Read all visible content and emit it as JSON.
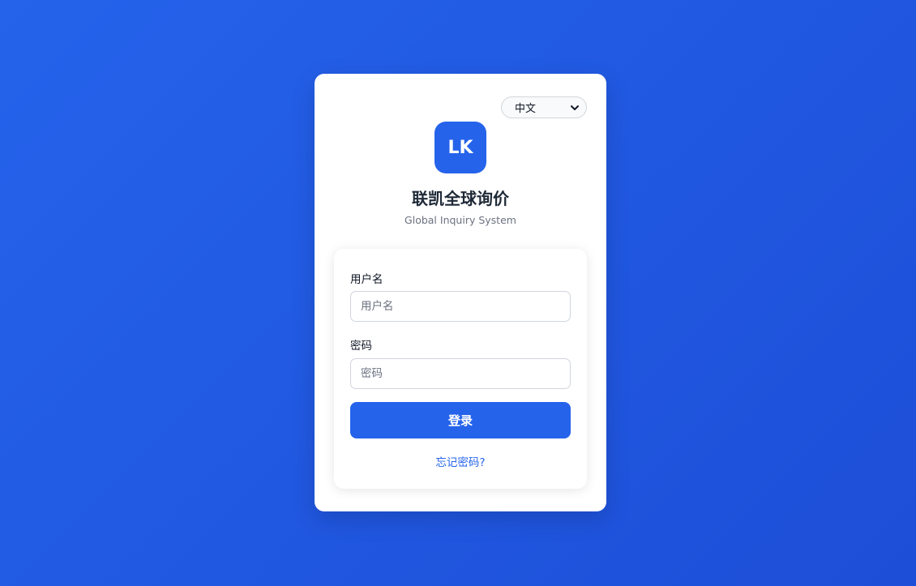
{
  "language": {
    "selected": "中文"
  },
  "logo": {
    "text": "LK"
  },
  "app": {
    "title": "联凯全球询价",
    "subtitle": "Global Inquiry System"
  },
  "form": {
    "username": {
      "label": "用户名",
      "placeholder": "用户名",
      "value": ""
    },
    "password": {
      "label": "密码",
      "placeholder": "密码",
      "value": ""
    },
    "login_label": "登录",
    "forgot_label": "忘记密码?"
  },
  "colors": {
    "background": "#2563eb",
    "primary": "#2563eb",
    "card": "#ffffff"
  }
}
